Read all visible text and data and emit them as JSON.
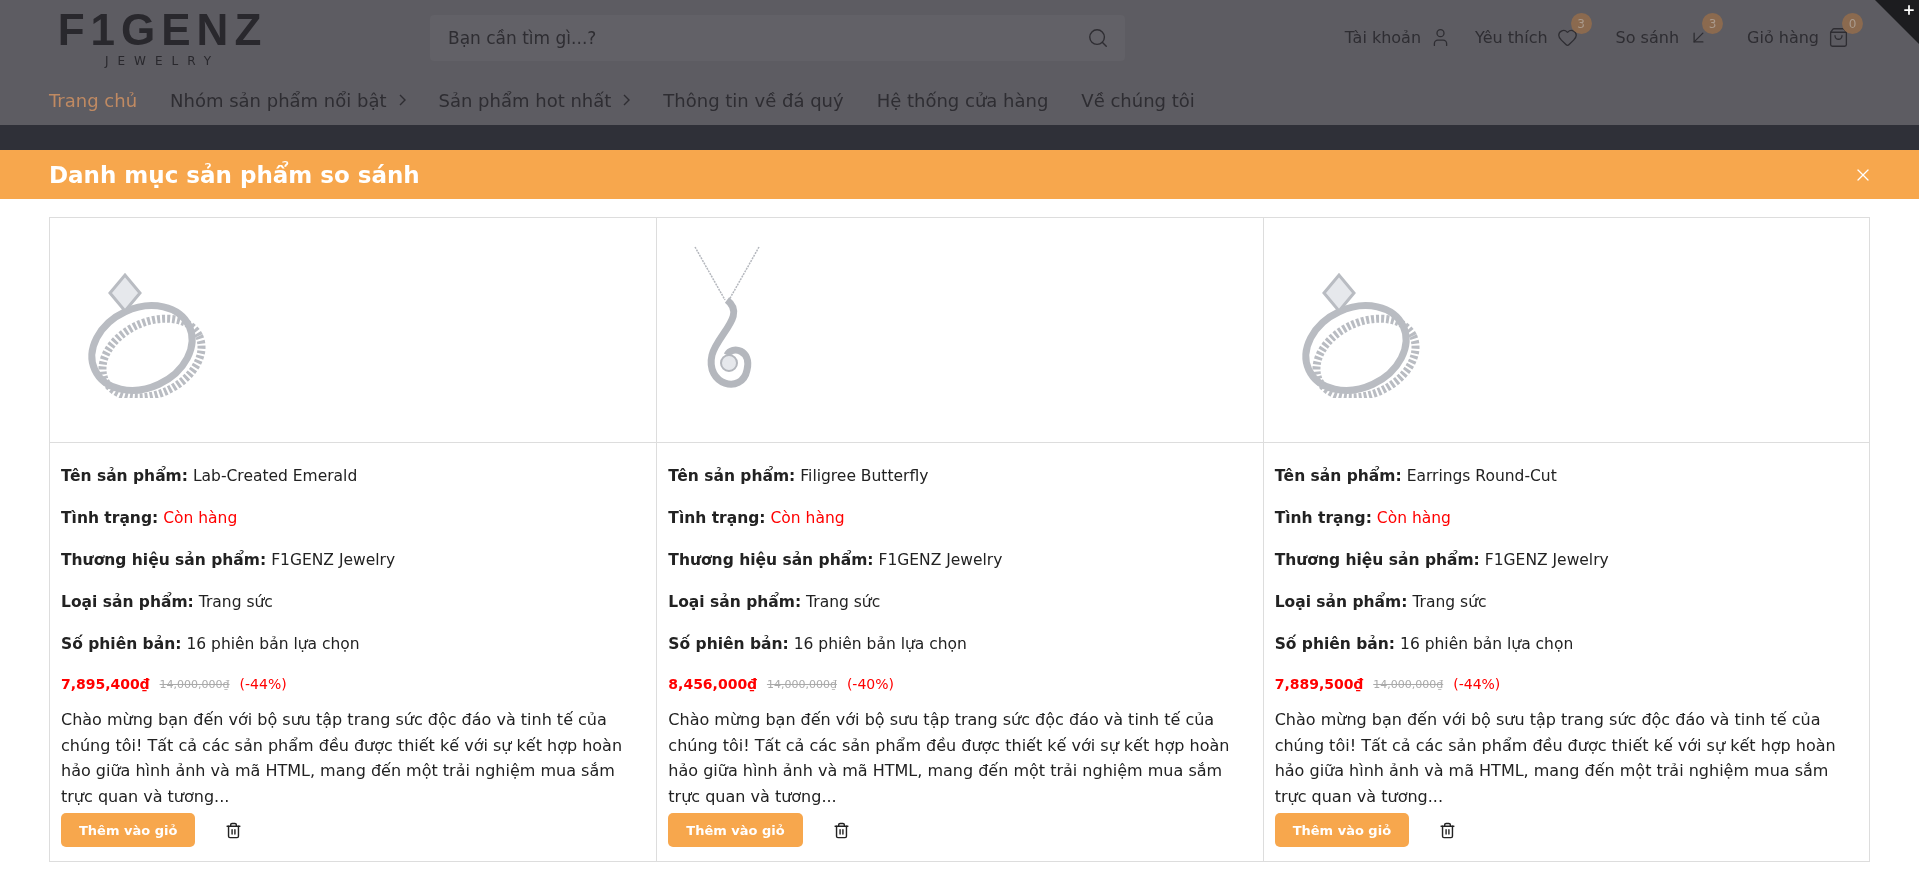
{
  "header": {
    "logo": {
      "name": "F1GENZ",
      "tagline": "JEWELRY"
    },
    "search": {
      "placeholder": "Bạn cần tìm gì...?"
    },
    "actions": [
      {
        "kind": "account",
        "label": "Tài khoản"
      },
      {
        "kind": "wishlist",
        "label": "Yêu thích",
        "count": "3"
      },
      {
        "kind": "compare",
        "label": "So sánh",
        "count": "3"
      },
      {
        "kind": "cart",
        "label": "Giỏ hàng",
        "count": "0"
      }
    ],
    "nav": [
      {
        "label": "Trang chủ",
        "selected": true,
        "submenu": false
      },
      {
        "label": "Nhóm sản phẩm nổi bật",
        "selected": false,
        "submenu": true
      },
      {
        "label": "Sản phẩm hot nhất",
        "selected": false,
        "submenu": true
      },
      {
        "label": "Thông tin về đá quý",
        "selected": false,
        "submenu": false
      },
      {
        "label": "Hệ thống cửa hàng",
        "selected": false,
        "submenu": false
      },
      {
        "label": "Về chúng tôi",
        "selected": false,
        "submenu": false
      }
    ]
  },
  "modal": {
    "title": "Danh mục sản phẩm so sánh",
    "products": [
      {
        "kind": "ring",
        "fields": [
          {
            "kind": "text",
            "label": "Tên sản phẩm:",
            "value": "Lab-Created Emerald"
          },
          {
            "kind": "status",
            "label": "Tình trạng:",
            "value": "Còn hàng"
          },
          {
            "kind": "text",
            "label": "Thương hiệu sản phẩm:",
            "value": "F1GENZ Jewelry"
          },
          {
            "kind": "text",
            "label": "Loại sản phẩm:",
            "value": "Trang sức"
          },
          {
            "kind": "text",
            "label": "Số phiên bản:",
            "value": "16 phiên bản lựa chọn"
          }
        ],
        "price": "7,895,400₫",
        "old_price": "14,000,000₫",
        "discount": "(-44%)",
        "description": "Chào mừng bạn đến với bộ sưu tập trang sức độc đáo và tinh tế của chúng tôi! Tất cả các sản phẩm đều được thiết kế với sự kết hợp hoàn hảo giữa hình ảnh và mã HTML, mang đến một trải nghiệm mua sắm trực quan và tương...",
        "button": "Thêm vào giỏ"
      },
      {
        "kind": "pendant",
        "fields": [
          {
            "kind": "text",
            "label": "Tên sản phẩm:",
            "value": "Filigree Butterfly"
          },
          {
            "kind": "status",
            "label": "Tình trạng:",
            "value": "Còn hàng"
          },
          {
            "kind": "text",
            "label": "Thương hiệu sản phẩm:",
            "value": "F1GENZ Jewelry"
          },
          {
            "kind": "text",
            "label": "Loại sản phẩm:",
            "value": "Trang sức"
          },
          {
            "kind": "text",
            "label": "Số phiên bản:",
            "value": "16 phiên bản lựa chọn"
          }
        ],
        "price": "8,456,000₫",
        "old_price": "14,000,000₫",
        "discount": "(-40%)",
        "description": "Chào mừng bạn đến với bộ sưu tập trang sức độc đáo và tinh tế của chúng tôi! Tất cả các sản phẩm đều được thiết kế với sự kết hợp hoàn hảo giữa hình ảnh và mã HTML, mang đến một trải nghiệm mua sắm trực quan và tương...",
        "button": "Thêm vào giỏ"
      },
      {
        "kind": "ring",
        "fields": [
          {
            "kind": "text",
            "label": "Tên sản phẩm:",
            "value": "Earrings Round-Cut"
          },
          {
            "kind": "status",
            "label": "Tình trạng:",
            "value": "Còn hàng"
          },
          {
            "kind": "text",
            "label": "Thương hiệu sản phẩm:",
            "value": "F1GENZ Jewelry"
          },
          {
            "kind": "text",
            "label": "Loại sản phẩm:",
            "value": "Trang sức"
          },
          {
            "kind": "text",
            "label": "Số phiên bản:",
            "value": "16 phiên bản lựa chọn"
          }
        ],
        "price": "7,889,500₫",
        "old_price": "14,000,000₫",
        "discount": "(-44%)",
        "description": "Chào mừng bạn đến với bộ sưu tập trang sức độc đáo và tinh tế của chúng tôi! Tất cả các sản phẩm đều được thiết kế với sự kết hợp hoàn hảo giữa hình ảnh và mã HTML, mang đến một trải nghiệm mua sắm trực quan và tương...",
        "button": "Thêm vào giỏ"
      }
    ]
  }
}
